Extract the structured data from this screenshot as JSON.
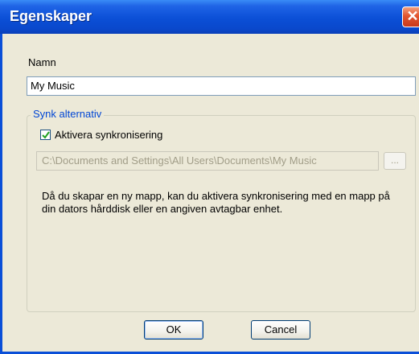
{
  "window": {
    "title": "Egenskaper",
    "close_icon": "close-icon"
  },
  "name_field": {
    "label": "Namn",
    "value": "My Music"
  },
  "sync_group": {
    "legend": "Synk alternativ",
    "enable_checkbox": {
      "label": "Aktivera synkronisering",
      "checked": true
    },
    "path_value": "C:\\Documents and Settings\\All Users\\Documents\\My Music",
    "browse_label": "...",
    "info_text": "Då du skapar en ny mapp, kan du aktivera synkronisering med en mapp på din dators hårddisk eller en angiven avtagbar enhet."
  },
  "buttons": {
    "ok": "OK",
    "cancel": "Cancel"
  },
  "colors": {
    "title_bar": "#0a4fd8",
    "dialog_bg": "#ece9d8",
    "group_legend": "#0046d5",
    "close_button": "#e2552f"
  }
}
